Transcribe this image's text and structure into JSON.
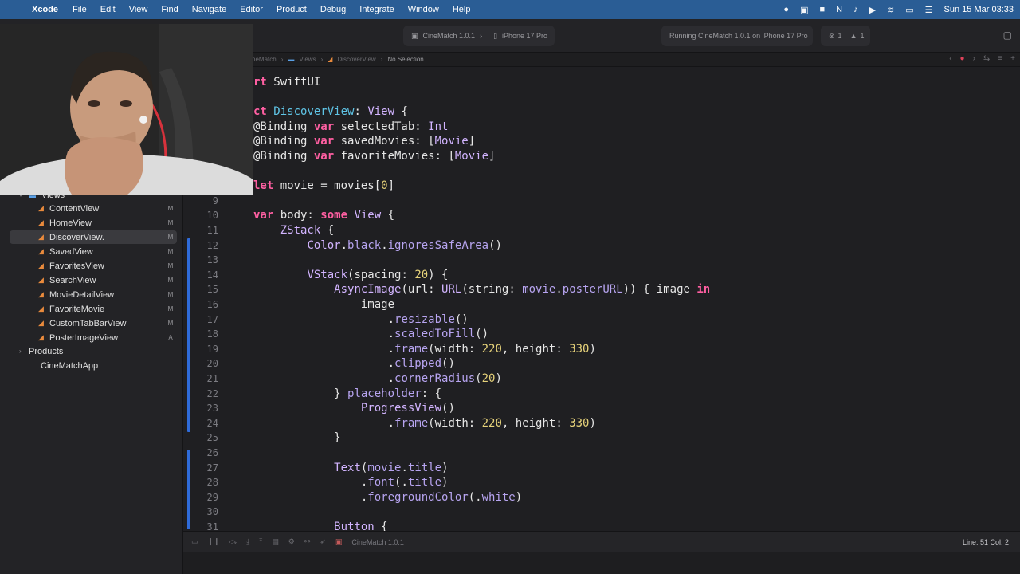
{
  "menubar": {
    "app_name": "Xcode",
    "items": [
      "File",
      "Edit",
      "View",
      "Find",
      "Navigate",
      "Editor",
      "Product",
      "Debug",
      "Integrate",
      "Window",
      "Help"
    ],
    "clock": "Sun 15 Mar 03:33"
  },
  "toolbar": {
    "scheme": "CineMatch 1.0.1",
    "scheme_separator": "›",
    "destination": "iPhone 17 Pro",
    "run_status": "Running CineMatch 1.0.1 on iPhone 17 Pro",
    "errors": "1",
    "warnings": "1"
  },
  "jumpbar": {
    "crumbs": [
      "neMatch",
      "Views",
      "DiscoverView"
    ],
    "current": "No Selection"
  },
  "navigator": {
    "folder_views": "Views",
    "files": [
      {
        "label": "ContentView",
        "badge": "M"
      },
      {
        "label": "HomeView",
        "badge": "M"
      },
      {
        "label": "DiscoverView.",
        "badge": "M"
      },
      {
        "label": "SavedView",
        "badge": "M"
      },
      {
        "label": "FavoritesView",
        "badge": "M"
      },
      {
        "label": "SearchView",
        "badge": "M"
      },
      {
        "label": "MovieDetailView",
        "badge": "M"
      },
      {
        "label": "FavoriteMovie",
        "badge": "M"
      },
      {
        "label": "CustomTabBarView",
        "badge": "M"
      },
      {
        "label": "PosterImageView",
        "badge": "A"
      }
    ],
    "folder_products": "Products",
    "folder_app": "CineMatchApp"
  },
  "editor": {
    "lines": [
      {
        "num": "",
        "tokens": [
          [
            "kw",
            "rt "
          ],
          [
            "plain",
            "SwiftUI"
          ]
        ]
      },
      {
        "num": "",
        "tokens": []
      },
      {
        "num": "",
        "tokens": [
          [
            "kw",
            "ct "
          ],
          [
            "decl",
            "DiscoverView"
          ],
          [
            "plain",
            ": "
          ],
          [
            "type",
            "View"
          ],
          [
            "plain",
            " {"
          ]
        ]
      },
      {
        "num": "",
        "tokens": [
          [
            "plain",
            "@Binding "
          ],
          [
            "kw",
            "var "
          ],
          [
            "plain",
            "selectedTab: "
          ],
          [
            "type",
            "Int"
          ]
        ]
      },
      {
        "num": "",
        "tokens": [
          [
            "plain",
            "@Binding "
          ],
          [
            "kw",
            "var "
          ],
          [
            "plain",
            "savedMovies: ["
          ],
          [
            "type",
            "Movie"
          ],
          [
            "plain",
            "]"
          ]
        ]
      },
      {
        "num": "",
        "tokens": [
          [
            "plain",
            "@Binding "
          ],
          [
            "kw",
            "var "
          ],
          [
            "plain",
            "favoriteMovies: ["
          ],
          [
            "type",
            "Movie"
          ],
          [
            "plain",
            "]"
          ]
        ]
      },
      {
        "num": "",
        "tokens": []
      },
      {
        "num": "",
        "tokens": [
          [
            "kw",
            "let "
          ],
          [
            "plain",
            "movie = movies["
          ],
          [
            "num",
            "0"
          ],
          [
            "plain",
            "]"
          ]
        ]
      },
      {
        "num": "9",
        "tokens": []
      },
      {
        "num": "10",
        "tokens": [
          [
            "kw",
            "var "
          ],
          [
            "plain",
            "body: "
          ],
          [
            "kw",
            "some "
          ],
          [
            "type",
            "View"
          ],
          [
            "plain",
            " {"
          ]
        ]
      },
      {
        "num": "11",
        "tokens": [
          [
            "plain",
            "    "
          ],
          [
            "type",
            "ZStack"
          ],
          [
            "plain",
            " {"
          ]
        ]
      },
      {
        "num": "12",
        "tokens": [
          [
            "plain",
            "        "
          ],
          [
            "type",
            "Color"
          ],
          [
            "plain",
            "."
          ],
          [
            "prop",
            "black"
          ],
          [
            "plain",
            "."
          ],
          [
            "prop",
            "ignoresSafeArea"
          ],
          [
            "plain",
            "()"
          ]
        ]
      },
      {
        "num": "13",
        "tokens": []
      },
      {
        "num": "14",
        "tokens": [
          [
            "plain",
            "        "
          ],
          [
            "type",
            "VStack"
          ],
          [
            "plain",
            "(spacing: "
          ],
          [
            "num",
            "20"
          ],
          [
            "plain",
            ") {"
          ]
        ]
      },
      {
        "num": "15",
        "tokens": [
          [
            "plain",
            "            "
          ],
          [
            "type",
            "AsyncImage"
          ],
          [
            "plain",
            "(url: "
          ],
          [
            "type",
            "URL"
          ],
          [
            "plain",
            "(string: "
          ],
          [
            "prop",
            "movie"
          ],
          [
            "plain",
            "."
          ],
          [
            "prop",
            "posterURL"
          ],
          [
            "plain",
            ")) { image "
          ],
          [
            "kw",
            "in"
          ]
        ]
      },
      {
        "num": "16",
        "tokens": [
          [
            "plain",
            "                image"
          ]
        ]
      },
      {
        "num": "17",
        "tokens": [
          [
            "plain",
            "                    ."
          ],
          [
            "prop",
            "resizable"
          ],
          [
            "plain",
            "()"
          ]
        ]
      },
      {
        "num": "18",
        "tokens": [
          [
            "plain",
            "                    ."
          ],
          [
            "prop",
            "scaledToFill"
          ],
          [
            "plain",
            "()"
          ]
        ]
      },
      {
        "num": "19",
        "tokens": [
          [
            "plain",
            "                    ."
          ],
          [
            "prop",
            "frame"
          ],
          [
            "plain",
            "(width: "
          ],
          [
            "num",
            "220"
          ],
          [
            "plain",
            ", height: "
          ],
          [
            "num",
            "330"
          ],
          [
            "plain",
            ")"
          ]
        ]
      },
      {
        "num": "20",
        "tokens": [
          [
            "plain",
            "                    ."
          ],
          [
            "prop",
            "clipped"
          ],
          [
            "plain",
            "()"
          ]
        ]
      },
      {
        "num": "21",
        "tokens": [
          [
            "plain",
            "                    ."
          ],
          [
            "prop",
            "cornerRadius"
          ],
          [
            "plain",
            "("
          ],
          [
            "num",
            "20"
          ],
          [
            "plain",
            ")"
          ]
        ]
      },
      {
        "num": "22",
        "tokens": [
          [
            "plain",
            "            } "
          ],
          [
            "prop",
            "placeholder"
          ],
          [
            "plain",
            ": {"
          ]
        ]
      },
      {
        "num": "23",
        "tokens": [
          [
            "plain",
            "                "
          ],
          [
            "type",
            "ProgressView"
          ],
          [
            "plain",
            "()"
          ]
        ]
      },
      {
        "num": "24",
        "tokens": [
          [
            "plain",
            "                    ."
          ],
          [
            "prop",
            "frame"
          ],
          [
            "plain",
            "(width: "
          ],
          [
            "num",
            "220"
          ],
          [
            "plain",
            ", height: "
          ],
          [
            "num",
            "330"
          ],
          [
            "plain",
            ")"
          ]
        ]
      },
      {
        "num": "25",
        "tokens": [
          [
            "plain",
            "            }"
          ]
        ]
      },
      {
        "num": "26",
        "tokens": []
      },
      {
        "num": "27",
        "tokens": [
          [
            "plain",
            "            "
          ],
          [
            "type",
            "Text"
          ],
          [
            "plain",
            "("
          ],
          [
            "prop",
            "movie"
          ],
          [
            "plain",
            "."
          ],
          [
            "prop",
            "title"
          ],
          [
            "plain",
            ")"
          ]
        ]
      },
      {
        "num": "28",
        "tokens": [
          [
            "plain",
            "                ."
          ],
          [
            "prop",
            "font"
          ],
          [
            "plain",
            "(."
          ],
          [
            "prop",
            "title"
          ],
          [
            "plain",
            ")"
          ]
        ]
      },
      {
        "num": "29",
        "tokens": [
          [
            "plain",
            "                ."
          ],
          [
            "prop",
            "foregroundColor"
          ],
          [
            "plain",
            "(."
          ],
          [
            "prop",
            "white"
          ],
          [
            "plain",
            ")"
          ]
        ]
      },
      {
        "num": "30",
        "tokens": []
      },
      {
        "num": "31",
        "tokens": [
          [
            "plain",
            "            "
          ],
          [
            "type",
            "Button"
          ],
          [
            "plain",
            " {"
          ]
        ]
      }
    ]
  },
  "debugbar": {
    "scheme": "CineMatch 1.0.1",
    "line_col": "Line: 51  Col: 2"
  },
  "colors": {
    "menubar": "#2a5d95",
    "keyword": "#ff5fa2",
    "type": "#d2b4ff",
    "declaration": "#5fc4e6",
    "number": "#e6d27a",
    "property": "#b7a4f0",
    "change_bar": "#2f6bd8"
  }
}
